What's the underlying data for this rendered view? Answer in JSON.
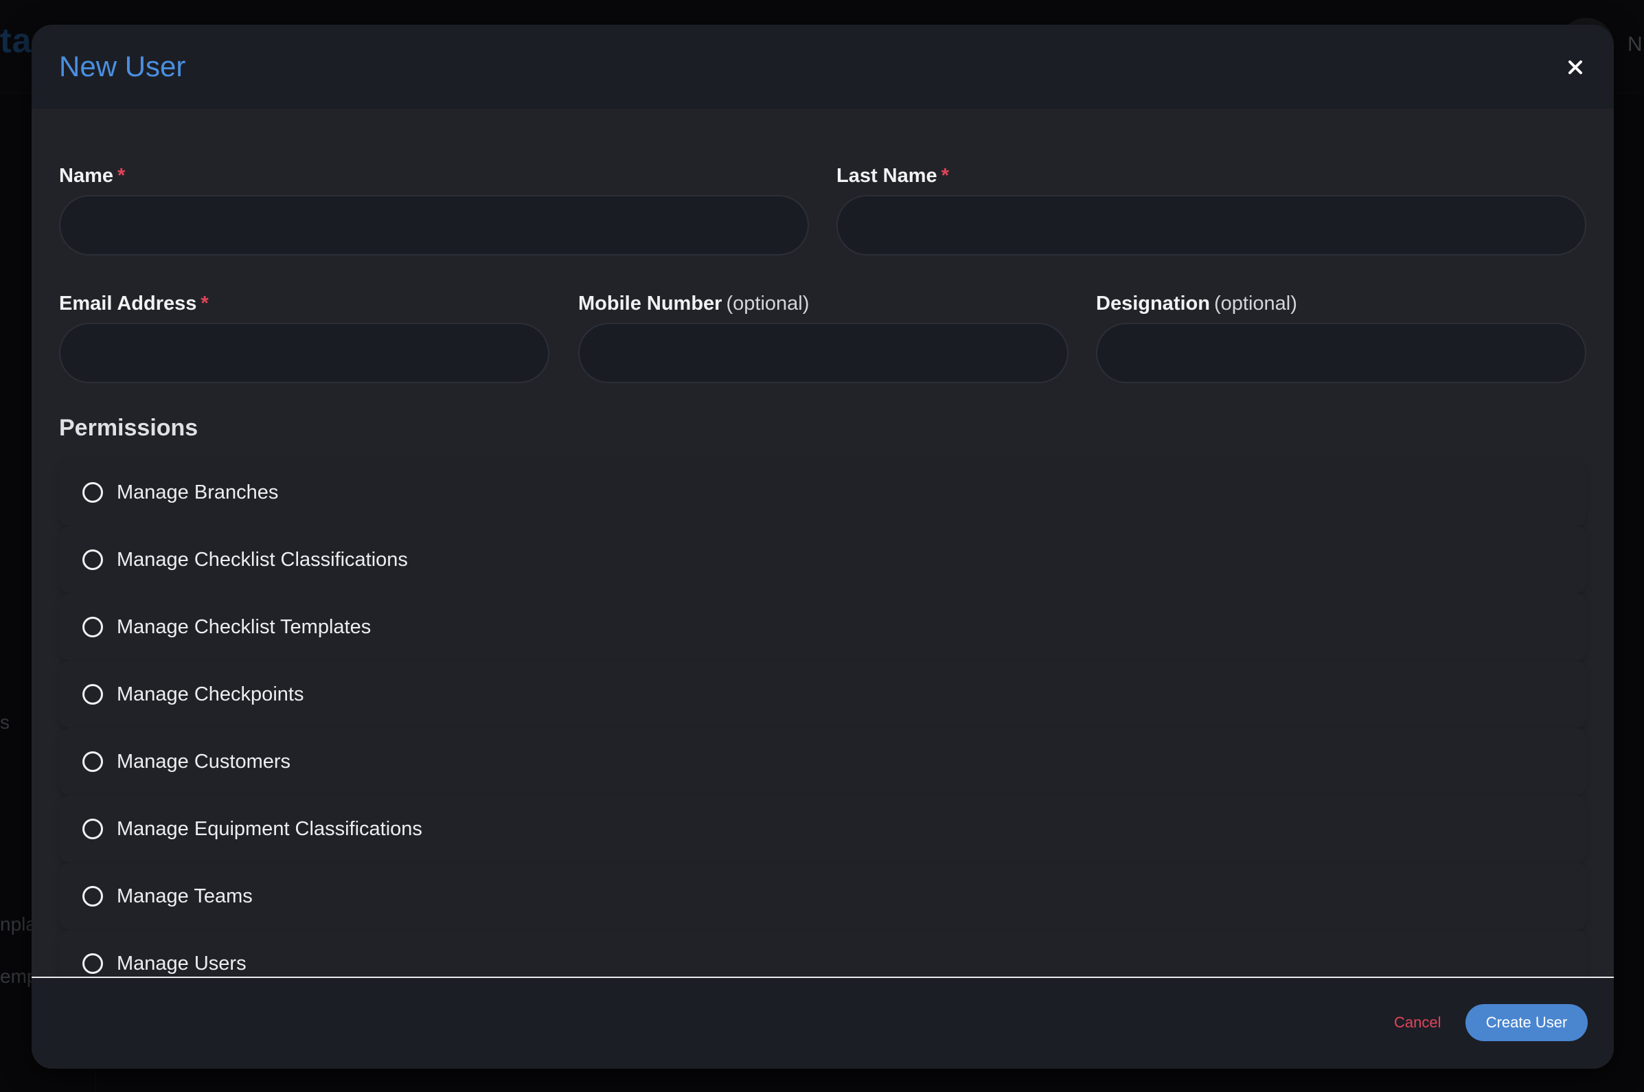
{
  "background": {
    "logo_fragment": "ta",
    "user_fragment": "N",
    "sidebar_fragments": [
      "s",
      "npla",
      "emp"
    ]
  },
  "modal": {
    "title": "New User",
    "close_icon": "close-icon"
  },
  "form": {
    "name": {
      "label": "Name",
      "required_mark": "*",
      "value": "",
      "placeholder": ""
    },
    "last_name": {
      "label": "Last Name",
      "required_mark": "*",
      "value": "",
      "placeholder": ""
    },
    "email": {
      "label": "Email Address",
      "required_mark": "*",
      "value": "",
      "placeholder": ""
    },
    "mobile": {
      "label": "Mobile Number",
      "optional_note": "(optional)",
      "value": "",
      "placeholder": ""
    },
    "designation": {
      "label": "Designation",
      "optional_note": "(optional)",
      "value": "",
      "placeholder": ""
    }
  },
  "permissions": {
    "title": "Permissions",
    "items": [
      {
        "label": "Manage Branches",
        "selected": false
      },
      {
        "label": "Manage Checklist Classifications",
        "selected": false
      },
      {
        "label": "Manage Checklist Templates",
        "selected": false
      },
      {
        "label": "Manage Checkpoints",
        "selected": false
      },
      {
        "label": "Manage Customers",
        "selected": false
      },
      {
        "label": "Manage Equipment Classifications",
        "selected": false
      },
      {
        "label": "Manage Teams",
        "selected": false
      },
      {
        "label": "Manage Users",
        "selected": false
      }
    ]
  },
  "footer": {
    "cancel_label": "Cancel",
    "create_label": "Create User"
  },
  "colors": {
    "accent": "#4a86d0",
    "title": "#4a8fe0",
    "danger": "#e0455a",
    "modal_bg": "#222328"
  }
}
